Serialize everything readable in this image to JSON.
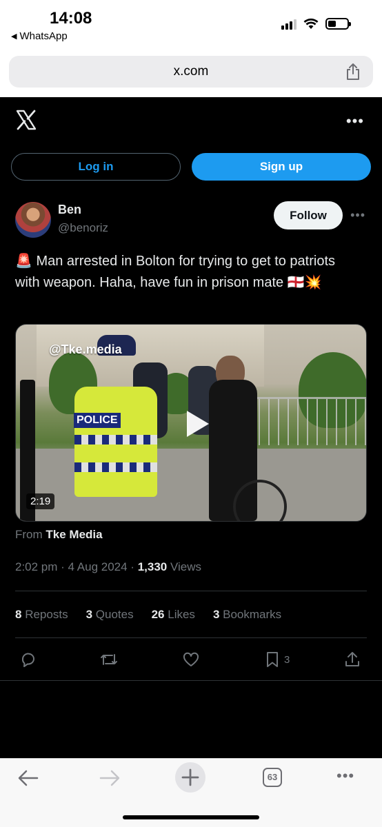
{
  "status_bar": {
    "time": "14:08",
    "back_app": "WhatsApp",
    "icons": [
      "cellular-signal-icon",
      "wifi-icon",
      "battery-icon"
    ]
  },
  "browser": {
    "url": "x.com",
    "toolbar": {
      "tabs_count": "63",
      "icons": [
        "back-icon",
        "forward-icon",
        "new-tab-icon",
        "tabs-icon",
        "more-icon"
      ]
    }
  },
  "header": {
    "logo": "x-logo-icon",
    "login_label": "Log in",
    "signup_label": "Sign up"
  },
  "tweet": {
    "author_name": "Ben",
    "author_handle": "@benoriz",
    "follow_label": "Follow",
    "text": "🚨 Man arrested in Bolton for trying to get to patriots with weapon. Haha, have fun in prison mate 🏴󠁧󠁢󠁥󠁮󠁧󠁿💥",
    "media": {
      "watermark": "@Tke.media",
      "duration": "2:19",
      "police_label": "POLICE",
      "from_prefix": "From",
      "from_source": "Tke Media"
    },
    "time": "2:02 pm",
    "date": "4 Aug 2024",
    "views_count": "1,330",
    "views_label": "Views",
    "stats": {
      "reposts_count": "8",
      "reposts_label": "Reposts",
      "quotes_count": "3",
      "quotes_label": "Quotes",
      "likes_count": "26",
      "likes_label": "Likes",
      "bookmarks_count": "3",
      "bookmarks_label": "Bookmarks"
    },
    "actions": {
      "bookmark_count": "3"
    }
  },
  "colors": {
    "accent": "#1d9bf0",
    "background": "#000000",
    "muted_text": "#71767b",
    "primary_text": "#e7e9ea"
  }
}
